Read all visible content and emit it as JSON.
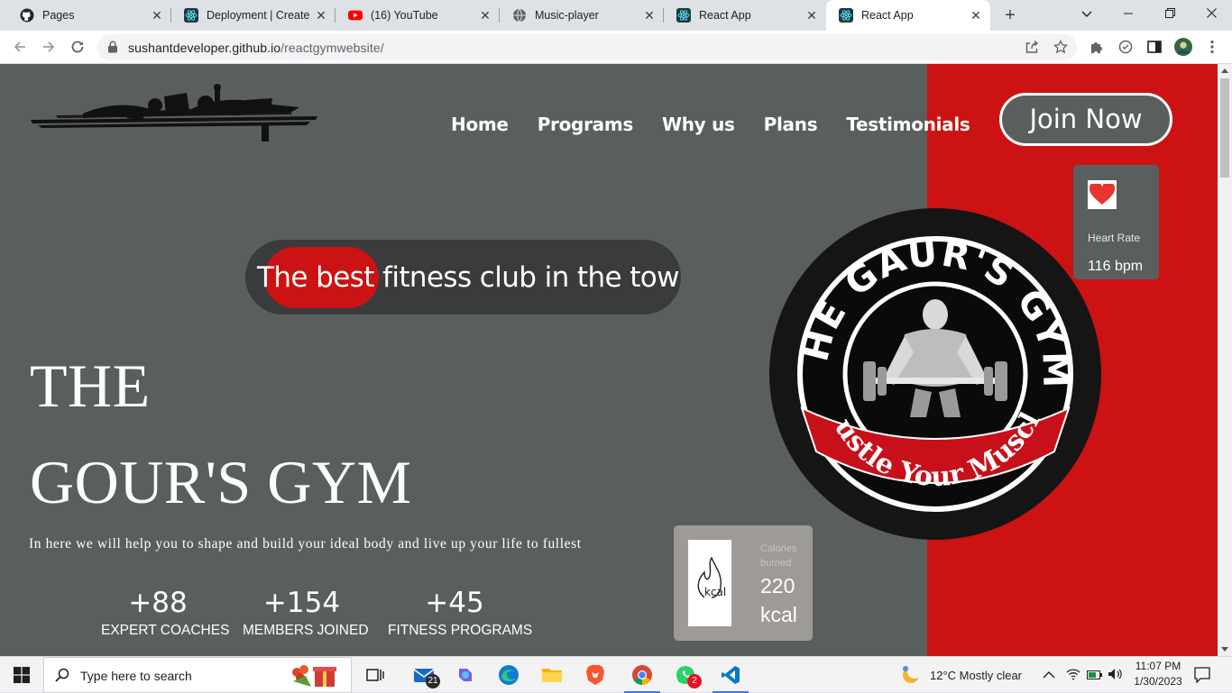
{
  "browser": {
    "tabs": [
      {
        "title": "Pages",
        "icon": "github-icon"
      },
      {
        "title": "Deployment | Create R",
        "icon": "react-icon"
      },
      {
        "title": "(16) YouTube",
        "icon": "youtube-icon"
      },
      {
        "title": "Music-player",
        "icon": "globe-icon"
      },
      {
        "title": "React App",
        "icon": "react-icon"
      },
      {
        "title": "React App",
        "icon": "react-icon"
      }
    ],
    "active_tab": 5,
    "url_host": "sushantdeveloper.github.io",
    "url_path": "/reactgymwebsite/"
  },
  "site": {
    "nav": [
      "Home",
      "Programs",
      "Why us",
      "Plans",
      "Testimonials"
    ],
    "join_label": "Join Now",
    "badge_text": "The best fitness club in the town",
    "title_line1": "THE",
    "title_line2": "GOUR'S GYM",
    "subtitle": "In here we will help you to shape and build your ideal body and live up your life to fullest",
    "stats": [
      {
        "number": "+88",
        "caption": "EXPERT COACHES"
      },
      {
        "number": "+154",
        "caption": "MEMBERS JOINED"
      },
      {
        "number": "+45",
        "caption": "FITNESS PROGRAMS"
      }
    ],
    "heart": {
      "label": "Heart Rate",
      "value": "116 bpm"
    },
    "calories": {
      "label": "Calories burned",
      "value": "220 kcal",
      "image_text": "kcal"
    },
    "logo_text_top": "THE GAUR'S GYM",
    "logo_text_bottom": "Hustle Your Muscle"
  },
  "taskbar": {
    "search_placeholder": "Type here to search",
    "mail_count": "21",
    "whatsapp_count": "2",
    "weather": "12°C  Mostly clear",
    "time": "11:07 PM",
    "date": "1/30/2023"
  },
  "colors": {
    "page_bg": "#5a5f5e",
    "accent_red": "#cc1212",
    "badge_bg": "#3a3b3d"
  }
}
